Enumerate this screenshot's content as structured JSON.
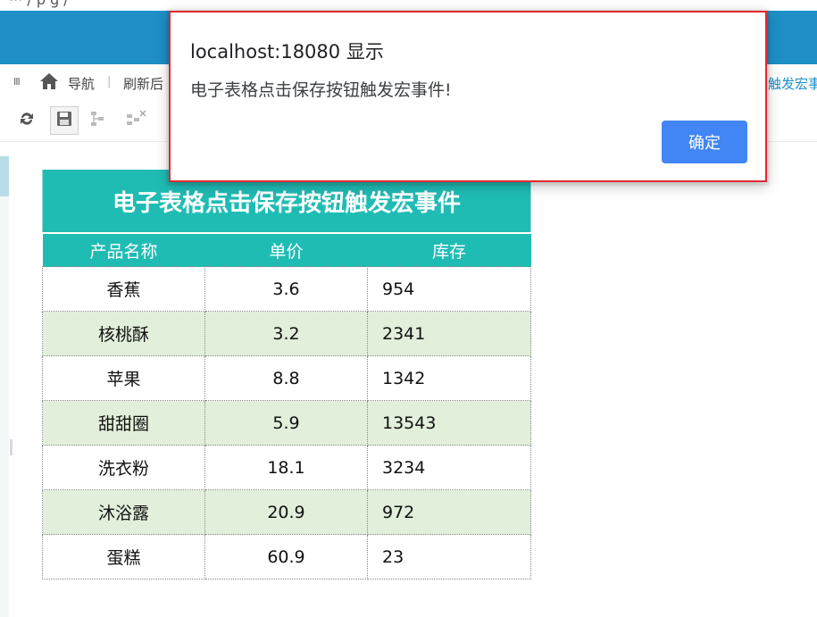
{
  "browser": {
    "url_fragment": "··· / p g /"
  },
  "nav": {
    "handle": "III",
    "home_label": "导航",
    "separator": "|",
    "tab_left": "刷新后",
    "tab_right": "触发宏事"
  },
  "toolbar": {
    "buttons": [
      "refresh-icon",
      "save-icon",
      "tree-icon",
      "tree-remove-icon"
    ]
  },
  "sheet": {
    "title": "电子表格点击保存按钮触发宏事件",
    "columns": [
      "产品名称",
      "单价",
      "库存"
    ],
    "rows": [
      {
        "name": "香蕉",
        "price": "3.6",
        "stock": "954"
      },
      {
        "name": "核桃酥",
        "price": "3.2",
        "stock": "2341"
      },
      {
        "name": "苹果",
        "price": "8.8",
        "stock": "1342"
      },
      {
        "name": "甜甜圈",
        "price": "5.9",
        "stock": "13543"
      },
      {
        "name": "洗衣粉",
        "price": "18.1",
        "stock": "3234"
      },
      {
        "name": "沐浴露",
        "price": "20.9",
        "stock": "972"
      },
      {
        "name": "蛋糕",
        "price": "60.9",
        "stock": "23"
      }
    ]
  },
  "dialog": {
    "title": "localhost:18080 显示",
    "message": "电子表格点击保存按钮触发宏事件!",
    "ok_label": "确定"
  },
  "colors": {
    "topbar": "#1e8fc6",
    "sheet_header": "#1fbcb4",
    "alt_row": "#e2efda",
    "dialog_border": "#e0282e",
    "ok_button": "#4285f4"
  }
}
